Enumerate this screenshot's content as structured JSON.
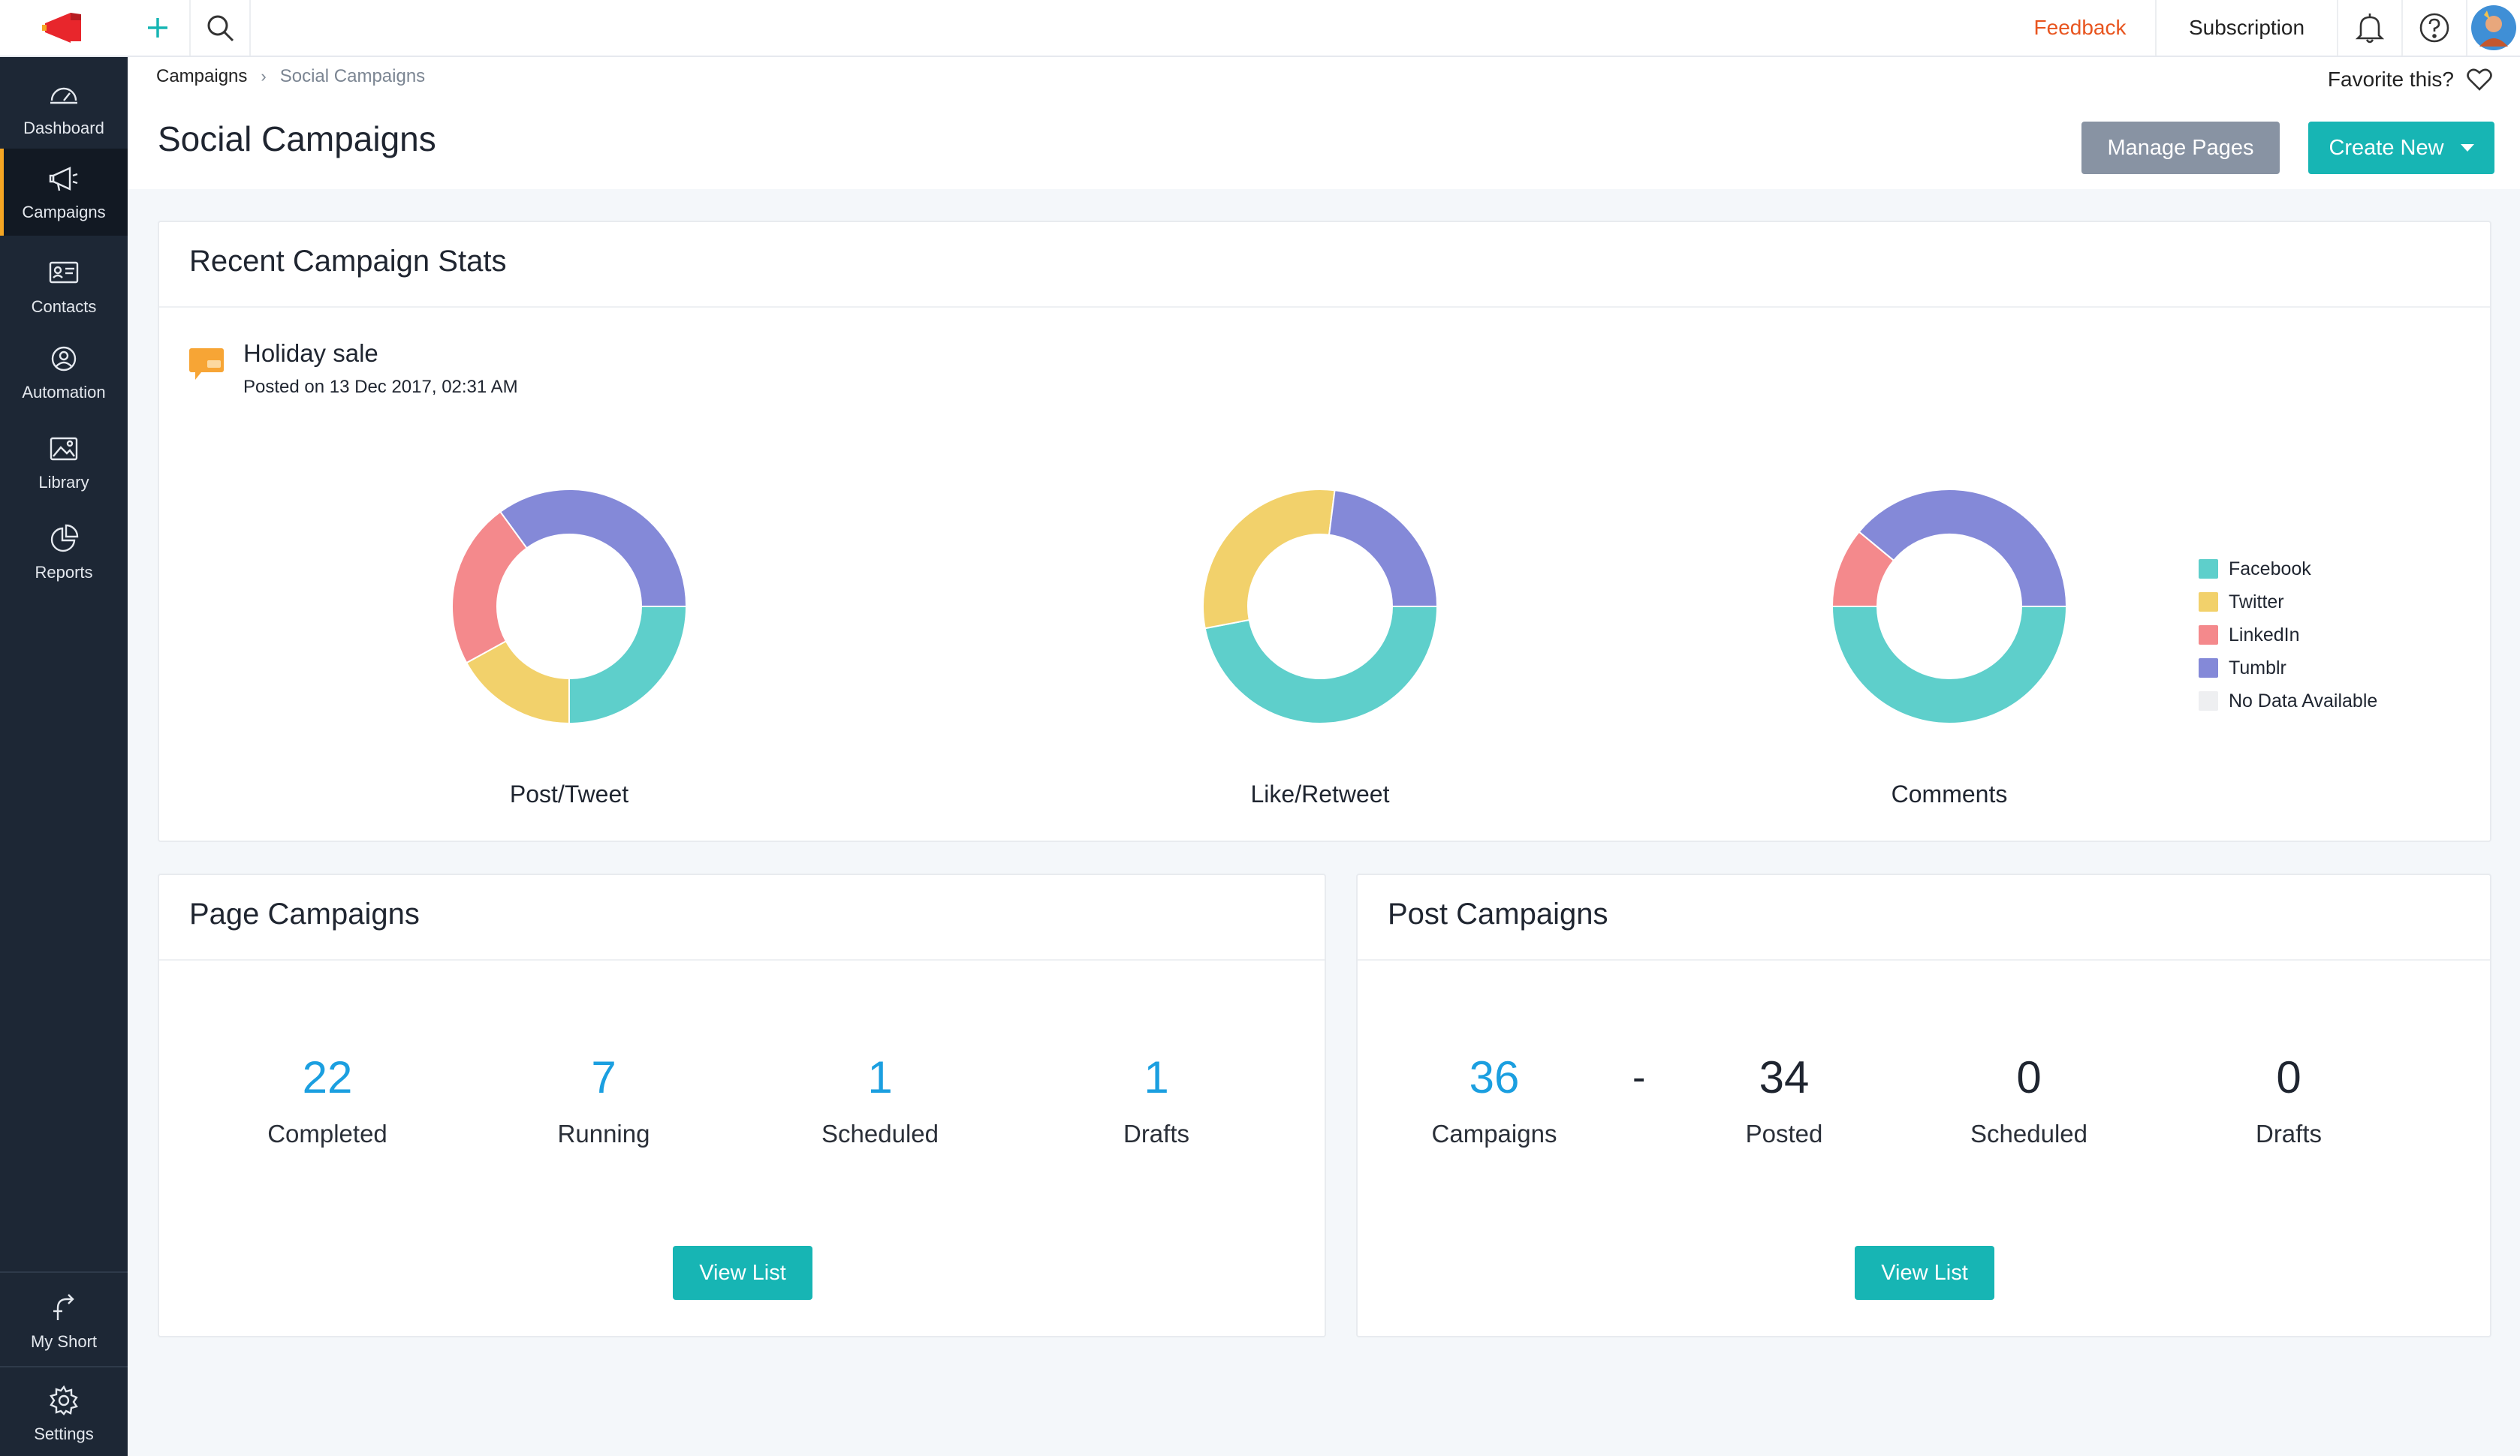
{
  "sidebar": {
    "items": [
      {
        "label": "Dashboard",
        "icon": "dashboard-icon"
      },
      {
        "label": "Campaigns",
        "icon": "megaphone-icon",
        "active": true
      },
      {
        "label": "Contacts",
        "icon": "contacts-icon"
      },
      {
        "label": "Automation",
        "icon": "automation-icon"
      },
      {
        "label": "Library",
        "icon": "image-icon"
      },
      {
        "label": "Reports",
        "icon": "pie-chart-icon"
      }
    ],
    "bottom": [
      {
        "label": "My Short",
        "icon": "shortcut-icon"
      },
      {
        "label": "Settings",
        "icon": "gear-icon"
      }
    ]
  },
  "topbar": {
    "feedback": "Feedback",
    "subscription": "Subscription"
  },
  "breadcrumb": {
    "parent": "Campaigns",
    "current": "Social Campaigns"
  },
  "favorite_label": "Favorite this?",
  "page_title": "Social Campaigns",
  "actions": {
    "manage_pages": "Manage Pages",
    "create_new": "Create New"
  },
  "recent_stats": {
    "title": "Recent Campaign Stats",
    "campaign_name": "Holiday sale",
    "posted_on": "Posted on 13 Dec 2017, 02:31 AM",
    "legend": [
      {
        "name": "Facebook",
        "color": "#5ecfcb"
      },
      {
        "name": "Twitter",
        "color": "#f2d16b"
      },
      {
        "name": "LinkedIn",
        "color": "#f4898c"
      },
      {
        "name": "Tumblr",
        "color": "#8489d8"
      },
      {
        "name": "No Data Available",
        "color": "#eeeff1"
      }
    ]
  },
  "chart_data": [
    {
      "type": "pie",
      "title": "Post/Tweet",
      "categories": [
        "Facebook",
        "Twitter",
        "LinkedIn",
        "Tumblr"
      ],
      "values": [
        25,
        17,
        23,
        35
      ]
    },
    {
      "type": "pie",
      "title": "Like/Retweet",
      "categories": [
        "Facebook",
        "Twitter",
        "LinkedIn",
        "Tumblr"
      ],
      "values": [
        47,
        30,
        0,
        23
      ]
    },
    {
      "type": "pie",
      "title": "Comments",
      "categories": [
        "Facebook",
        "Twitter",
        "LinkedIn",
        "Tumblr"
      ],
      "values": [
        50,
        0,
        11,
        39
      ]
    }
  ],
  "page_campaigns": {
    "title": "Page Campaigns",
    "stats": [
      {
        "value": "22",
        "label": "Completed"
      },
      {
        "value": "7",
        "label": "Running"
      },
      {
        "value": "1",
        "label": "Scheduled"
      },
      {
        "value": "1",
        "label": "Drafts"
      }
    ],
    "view_list": "View List"
  },
  "post_campaigns": {
    "title": "Post Campaigns",
    "stats": [
      {
        "value": "36",
        "label": "Campaigns"
      },
      {
        "value": "34",
        "label": "Posted"
      },
      {
        "value": "0",
        "label": "Scheduled"
      },
      {
        "value": "0",
        "label": "Drafts"
      }
    ],
    "separator": "-",
    "view_list": "View List"
  }
}
